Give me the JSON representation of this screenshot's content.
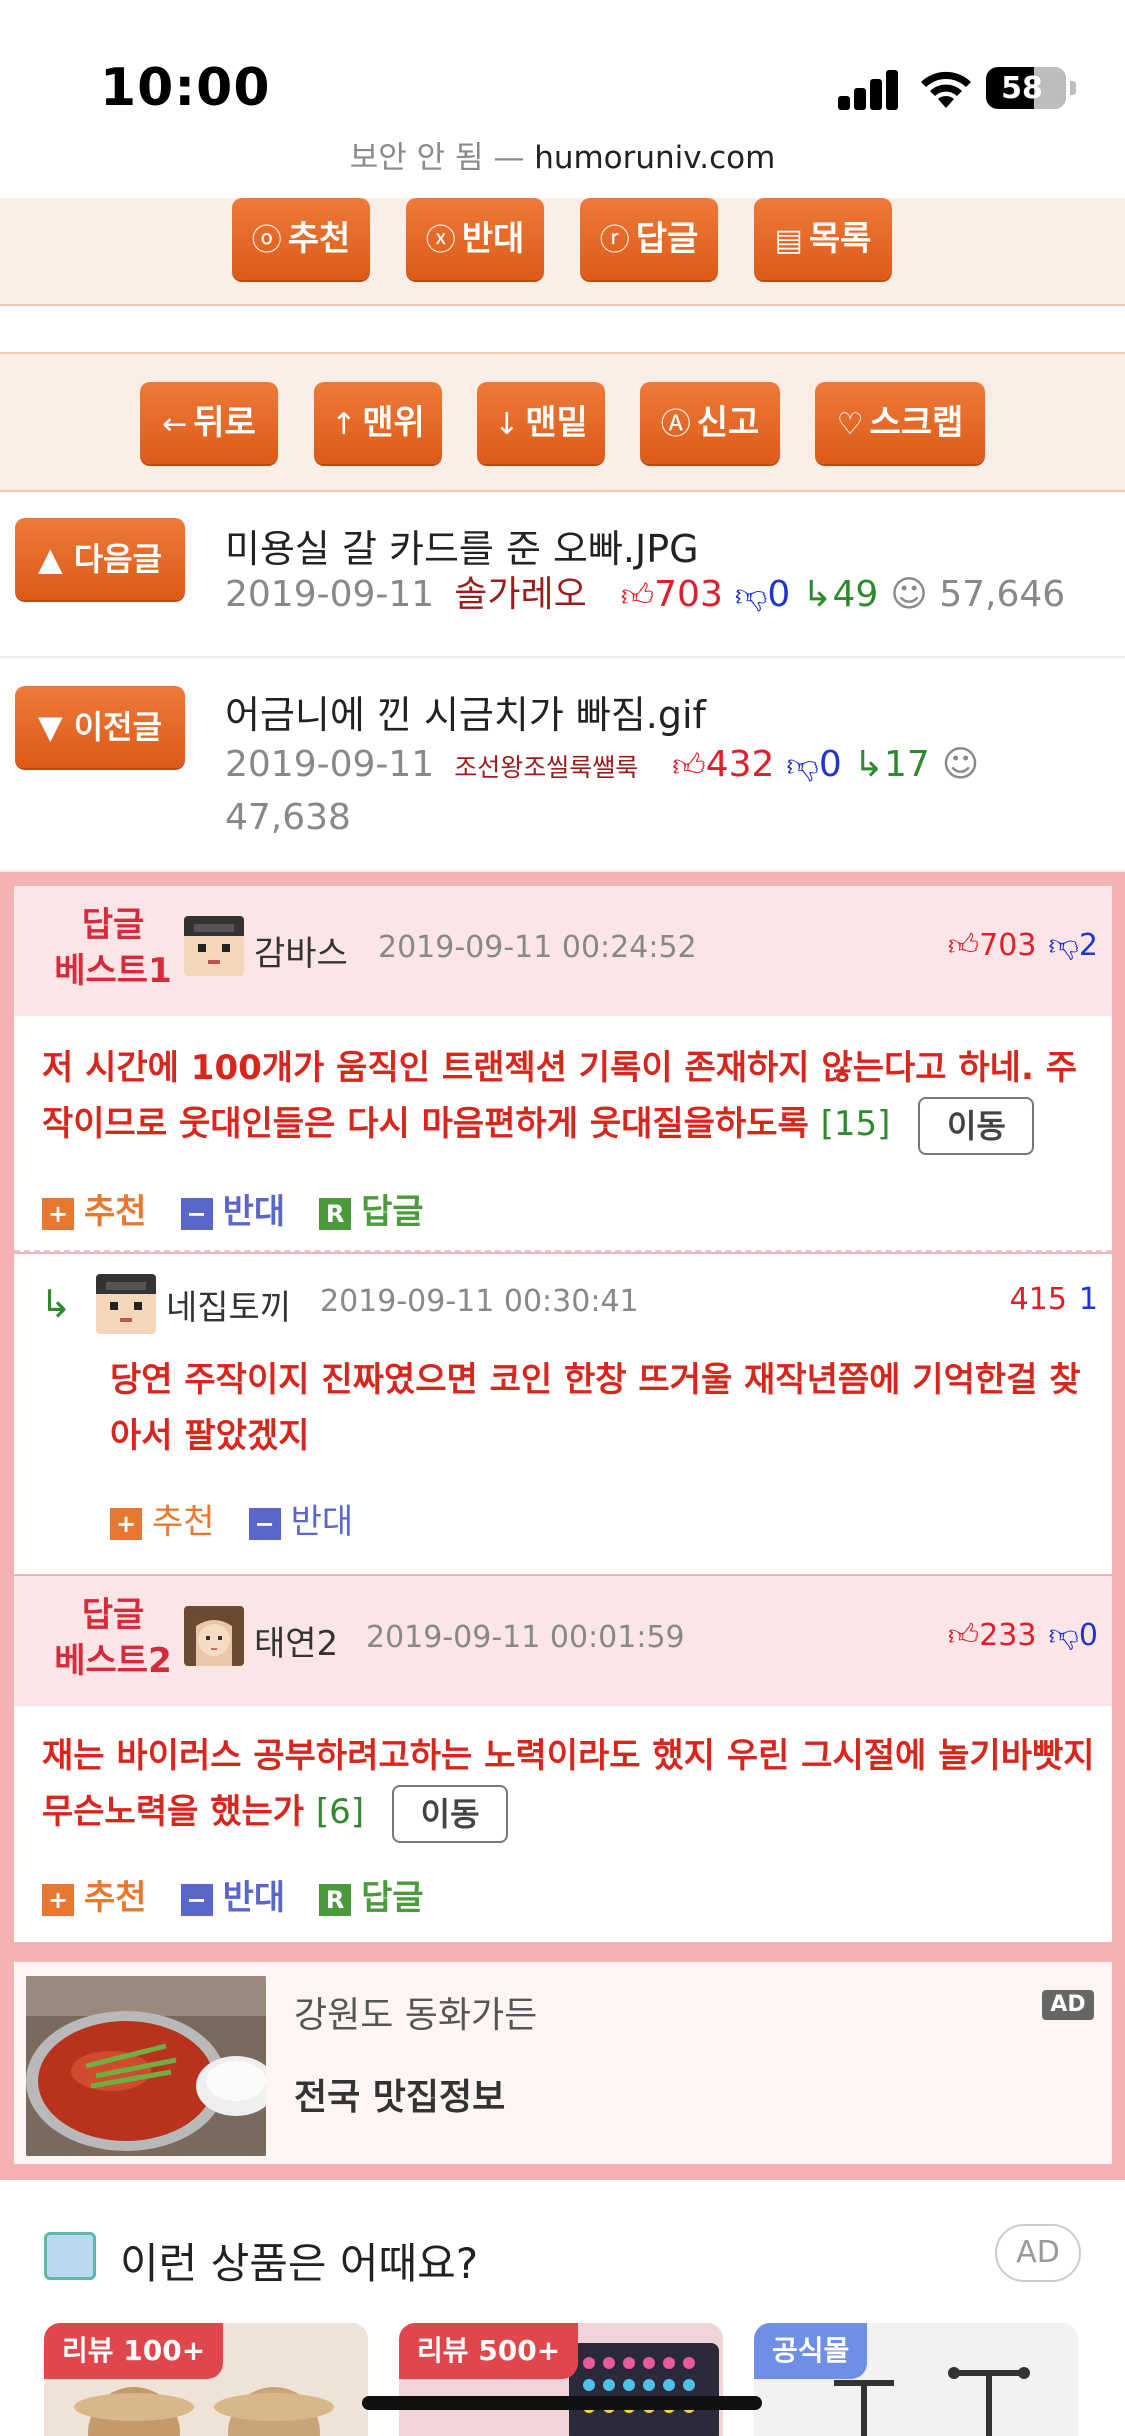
{
  "status": {
    "time": "10:00",
    "battery": "58"
  },
  "url": {
    "prefix": "보안 안 됨 — ",
    "host": "humoruniv.com"
  },
  "topButtons": [
    {
      "icon": "ⓞ",
      "label": "추천"
    },
    {
      "icon": "ⓧ",
      "label": "반대"
    },
    {
      "icon": "ⓡ",
      "label": "답글"
    },
    {
      "icon": "▤",
      "label": "목록"
    }
  ],
  "navButtons": [
    {
      "icon": "←",
      "label": "뒤로"
    },
    {
      "icon": "↑",
      "label": "맨위"
    },
    {
      "icon": "↓",
      "label": "맨밑"
    },
    {
      "icon": "Ⓐ",
      "label": "신고"
    },
    {
      "icon": "♡",
      "label": "스크랩"
    }
  ],
  "nextPost": {
    "button": "▲ 다음글",
    "title": "미용실 갈 카드를 준 오빠.JPG",
    "date": "2019-09-11",
    "author": "솔가레오",
    "up": "703",
    "down": "0",
    "replies": "49",
    "views": "57,646"
  },
  "prevPost": {
    "button": "▼ 이전글",
    "title": "어금니에 낀 시금치가 빠짐.gif",
    "date": "2019-09-11",
    "author": "조선왕조씰룩쌜룩",
    "up": "432",
    "down": "0",
    "replies": "17",
    "views": "47,638"
  },
  "comments": {
    "best1": {
      "label1": "답글",
      "label2": "베스트1",
      "name": "감바스",
      "date": "2019-09-11 00:24:52",
      "up": "703",
      "down": "2",
      "text": "저 시간에 100개가 움직인 트랜젝션 기록이 존재하지 않는다고 하네. 주작이므로 웃대인들은 다시 마음편하게 웃대질을하도록",
      "count": "[15]",
      "move": "이동",
      "rec": "추천",
      "opp": "반대",
      "rep": "답글"
    },
    "reply1": {
      "name": "네집토끼",
      "date": "2019-09-11 00:30:41",
      "up": "415",
      "down": "1",
      "text": "당연 주작이지 진짜였으면 코인 한창 뜨거울 재작년쯤에 기억한걸 찾아서 팔았겠지",
      "rec": "추천",
      "opp": "반대"
    },
    "best2": {
      "label1": "답글",
      "label2": "베스트2",
      "name": "태연2",
      "date": "2019-09-11 00:01:59",
      "up": "233",
      "down": "0",
      "text": "재는 바이러스 공부하려고하는 노력이라도 했지 우린 그시절에 놀기바빳지 무슨노력을 했는가",
      "count": "[6]",
      "move": "이동",
      "rec": "추천",
      "opp": "반대",
      "rep": "답글"
    }
  },
  "ad": {
    "line1": "강원도 동화가든",
    "line2": "전국 맛집정보",
    "badge": "AD"
  },
  "products": {
    "heading": "이런 상품은 어때요?",
    "adLabel": "AD",
    "cards": [
      {
        "tag": "리뷰 100+",
        "color": "#e0474c"
      },
      {
        "tag": "리뷰 500+",
        "color": "#e0474c"
      },
      {
        "tag": "공식몰",
        "color": "#6f8fe6"
      }
    ]
  }
}
